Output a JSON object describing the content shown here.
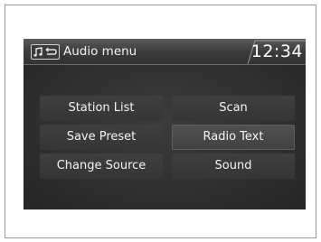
{
  "header": {
    "icon": "audio-source-icon",
    "title": "Audio menu",
    "clock": "12:34"
  },
  "menu": {
    "rows": [
      {
        "left": "Station List",
        "right": "Scan"
      },
      {
        "left": "Save Preset",
        "right": "Radio Text"
      },
      {
        "left": "Change Source",
        "right": "Sound"
      }
    ]
  },
  "colors": {
    "screen_bg": "#2e2e2e",
    "text": "#f4f4f4"
  }
}
